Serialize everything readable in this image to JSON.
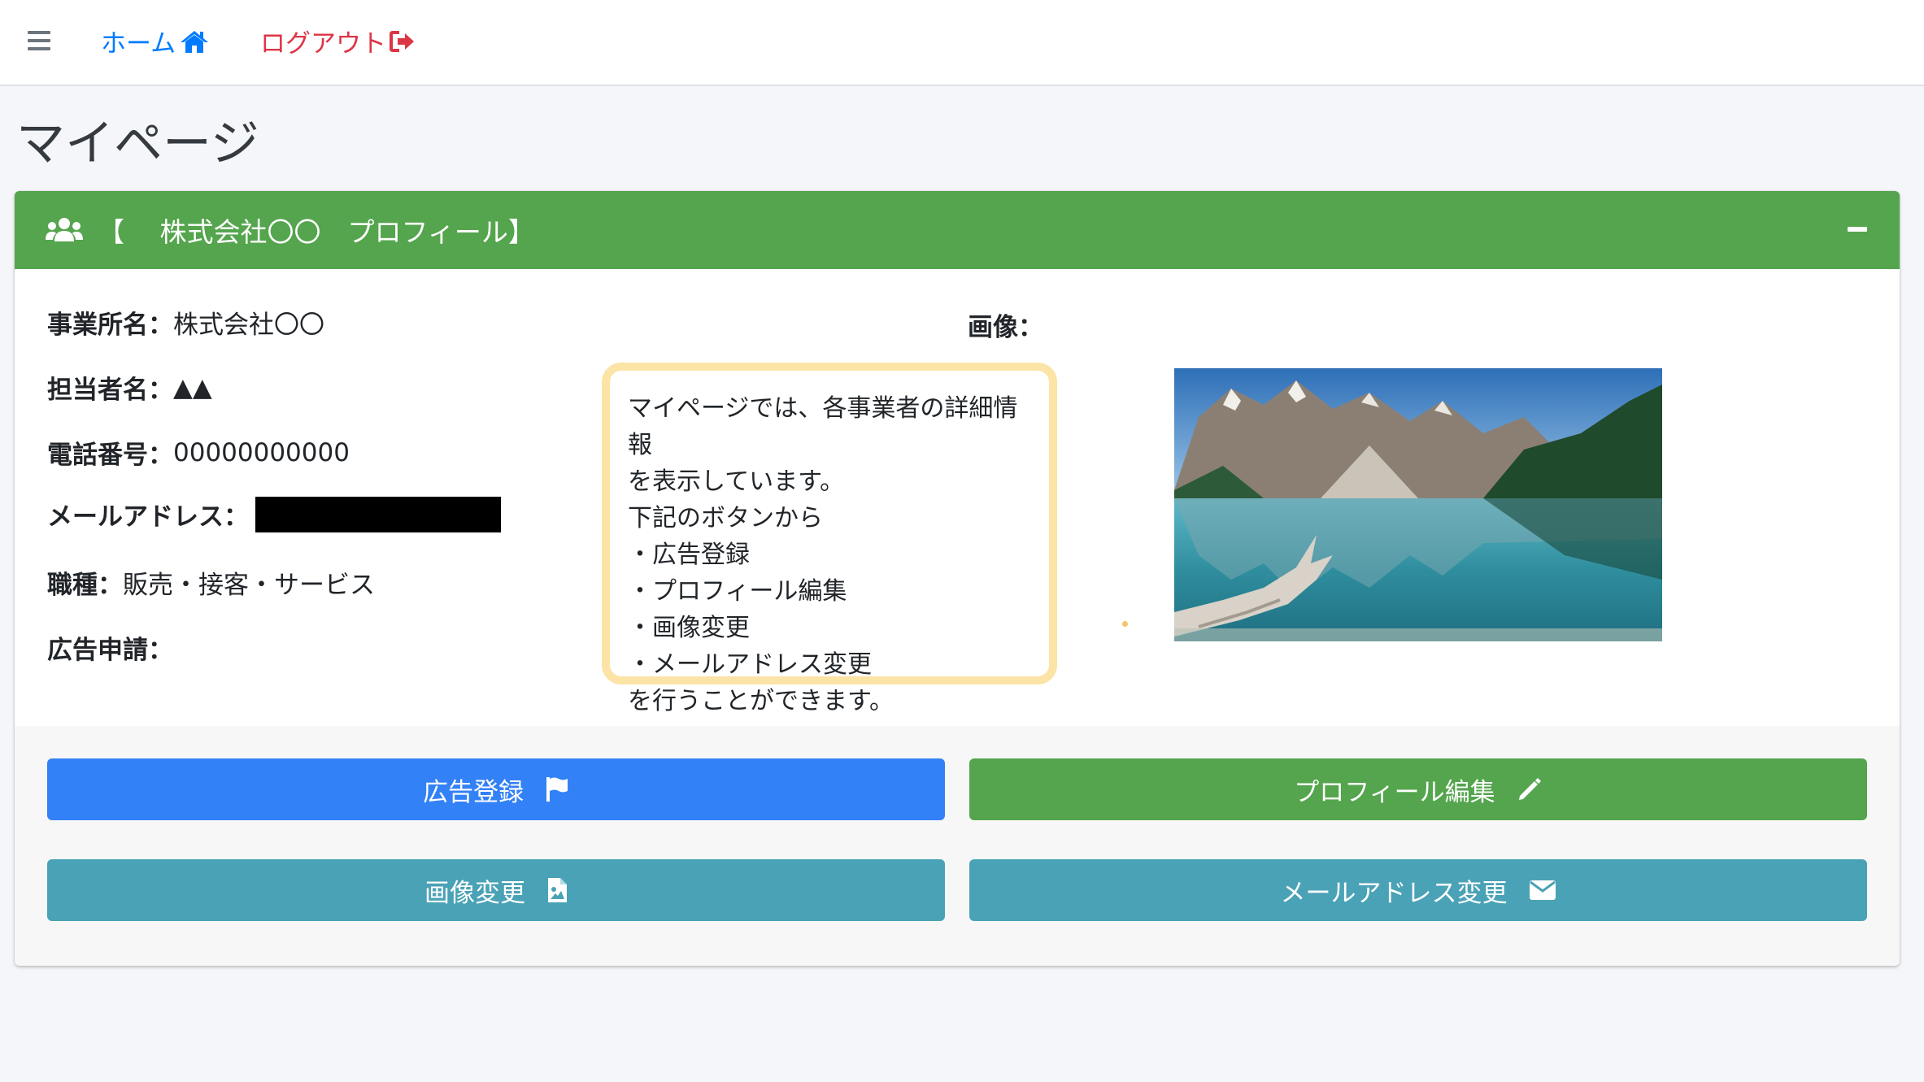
{
  "nav": {
    "home_label": "ホーム",
    "logout_label": "ログアウト"
  },
  "page": {
    "title": "マイページ"
  },
  "card": {
    "title": "【　 株式会社〇〇　プロフィール】",
    "fields": [
      {
        "label": "事業所名：",
        "value": "株式会社〇〇"
      },
      {
        "label": "担当者名：",
        "value": "▲▲"
      },
      {
        "label": "電話番号：",
        "value": "00000000000"
      },
      {
        "label": "メールアドレス：",
        "value": ""
      },
      {
        "label": "職種：",
        "value": "販売・接客・サービス"
      },
      {
        "label": "広告申請：",
        "value": ""
      }
    ],
    "image_label": "画像："
  },
  "callout": {
    "lines": [
      "マイページでは、各事業者の詳細情報",
      "を表示しています。",
      "下記のボタンから",
      "・広告登録",
      "・プロフィール編集",
      "・画像変更",
      "・メールアドレス変更",
      "を行うことができます。"
    ]
  },
  "buttons": {
    "ad_register": "広告登録",
    "profile_edit": "プロフィール編集",
    "image_change": "画像変更",
    "email_change": "メールアドレス変更"
  },
  "colors": {
    "primary": "#3381f6",
    "success": "#54a54d",
    "info": "#4aa2b6",
    "danger": "#dc3545",
    "link": "#007bff",
    "callout_border": "#fbe4a6"
  },
  "icons": {
    "menu": "hamburger-icon",
    "home": "home-icon",
    "logout": "sign-out-icon",
    "header": "users-icon",
    "collapse": "minus-icon",
    "ad": "flag-icon",
    "edit": "pencil-icon",
    "image": "file-image-icon",
    "email": "envelope-icon"
  }
}
